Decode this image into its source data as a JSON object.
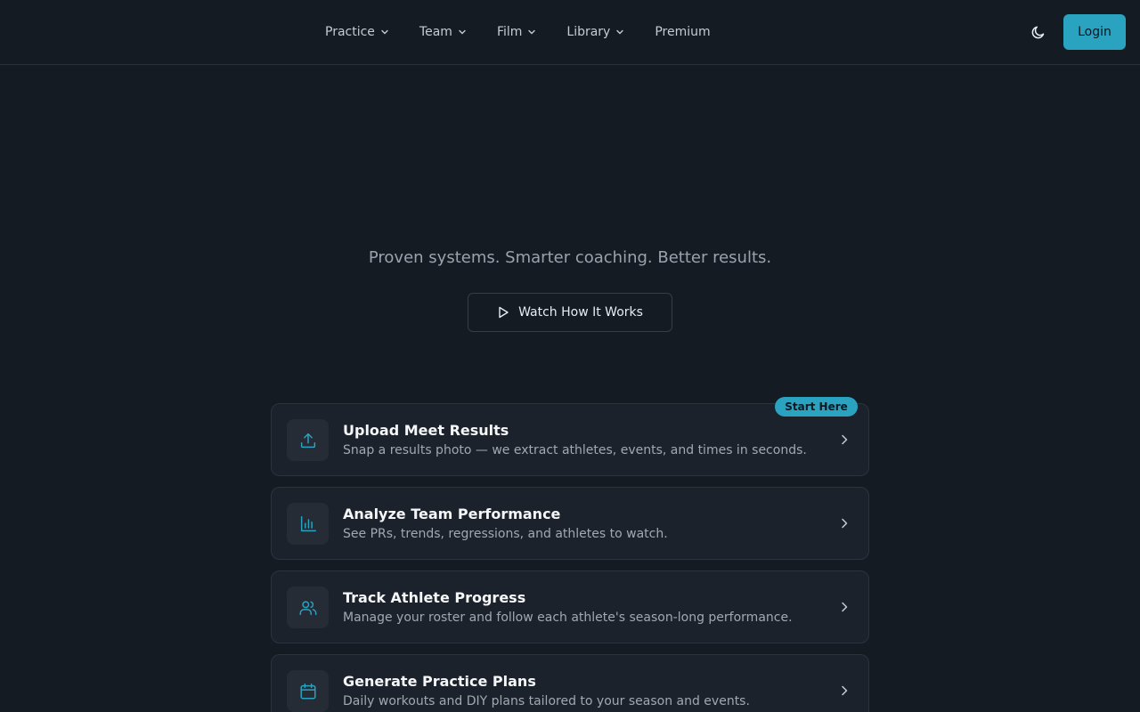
{
  "nav": {
    "items": [
      {
        "label": "Practice",
        "has_dropdown": true
      },
      {
        "label": "Team",
        "has_dropdown": true
      },
      {
        "label": "Film",
        "has_dropdown": true
      },
      {
        "label": "Library",
        "has_dropdown": true
      },
      {
        "label": "Premium",
        "has_dropdown": false
      }
    ],
    "theme_icon": "moon-icon",
    "login_label": "Login"
  },
  "hero": {
    "tagline": "Proven systems. Smarter coaching. Better results.",
    "watch_label": "Watch How It Works",
    "watch_icon": "play-icon"
  },
  "cards": [
    {
      "title": "Upload Meet Results",
      "description": "Snap a results photo — we extract athletes, events, and times in seconds.",
      "icon": "upload-icon",
      "badge": "Start Here"
    },
    {
      "title": "Analyze Team Performance",
      "description": "See PRs, trends, regressions, and athletes to watch.",
      "icon": "bar-chart-icon"
    },
    {
      "title": "Track Athlete Progress",
      "description": "Manage your roster and follow each athlete's season-long performance.",
      "icon": "users-icon"
    },
    {
      "title": "Generate Practice Plans",
      "description": "Daily workouts and DIY plans tailored to your season and events.",
      "icon": "calendar-icon"
    }
  ],
  "colors": {
    "background": "#151b23",
    "accent": "#2aa3c1",
    "card": "#1c222b"
  }
}
